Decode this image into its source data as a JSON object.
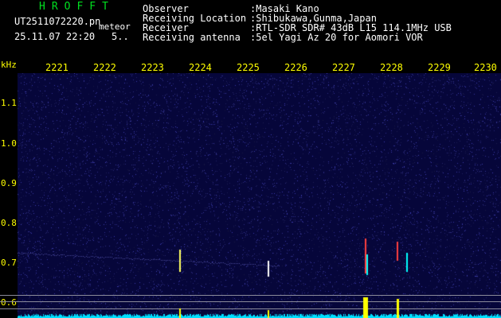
{
  "header": {
    "brand": "HROFFT",
    "filename": "UT2511072220.pn",
    "meteor_label": "meteor",
    "datetime": "25.11.07 22:20",
    "extra": "5..",
    "fields": [
      {
        "label": "Observer",
        "value": ":Masaki Kano"
      },
      {
        "label": "Receiving Location",
        "value": ":Shibukawa,Gunma,Japan"
      },
      {
        "label": "Receiver",
        "value": ":RTL-SDR SDR# 43dB L15 114.1MHz USB"
      },
      {
        "label": "Receiving antenna",
        "value": ":5el Yagi Az 20 for Aomori VOR"
      }
    ]
  },
  "axis": {
    "unit_label": "kHz",
    "time_ticks": [
      "2221",
      "2222",
      "2223",
      "2224",
      "2225",
      "2226",
      "2227",
      "2228",
      "2229",
      "2230"
    ],
    "freq_ticks": [
      "1.1",
      "1.0",
      "0.9",
      "0.8",
      "0.7",
      "0.6"
    ]
  },
  "colors": {
    "background": "#000000",
    "waterfall_base": "#06063a",
    "text": "#ffffff",
    "brand": "#00e020",
    "ticks": "#ffff00",
    "meteor": "#ff4040",
    "echo": "#00ffff",
    "amplitude": "#00e0ff"
  }
}
